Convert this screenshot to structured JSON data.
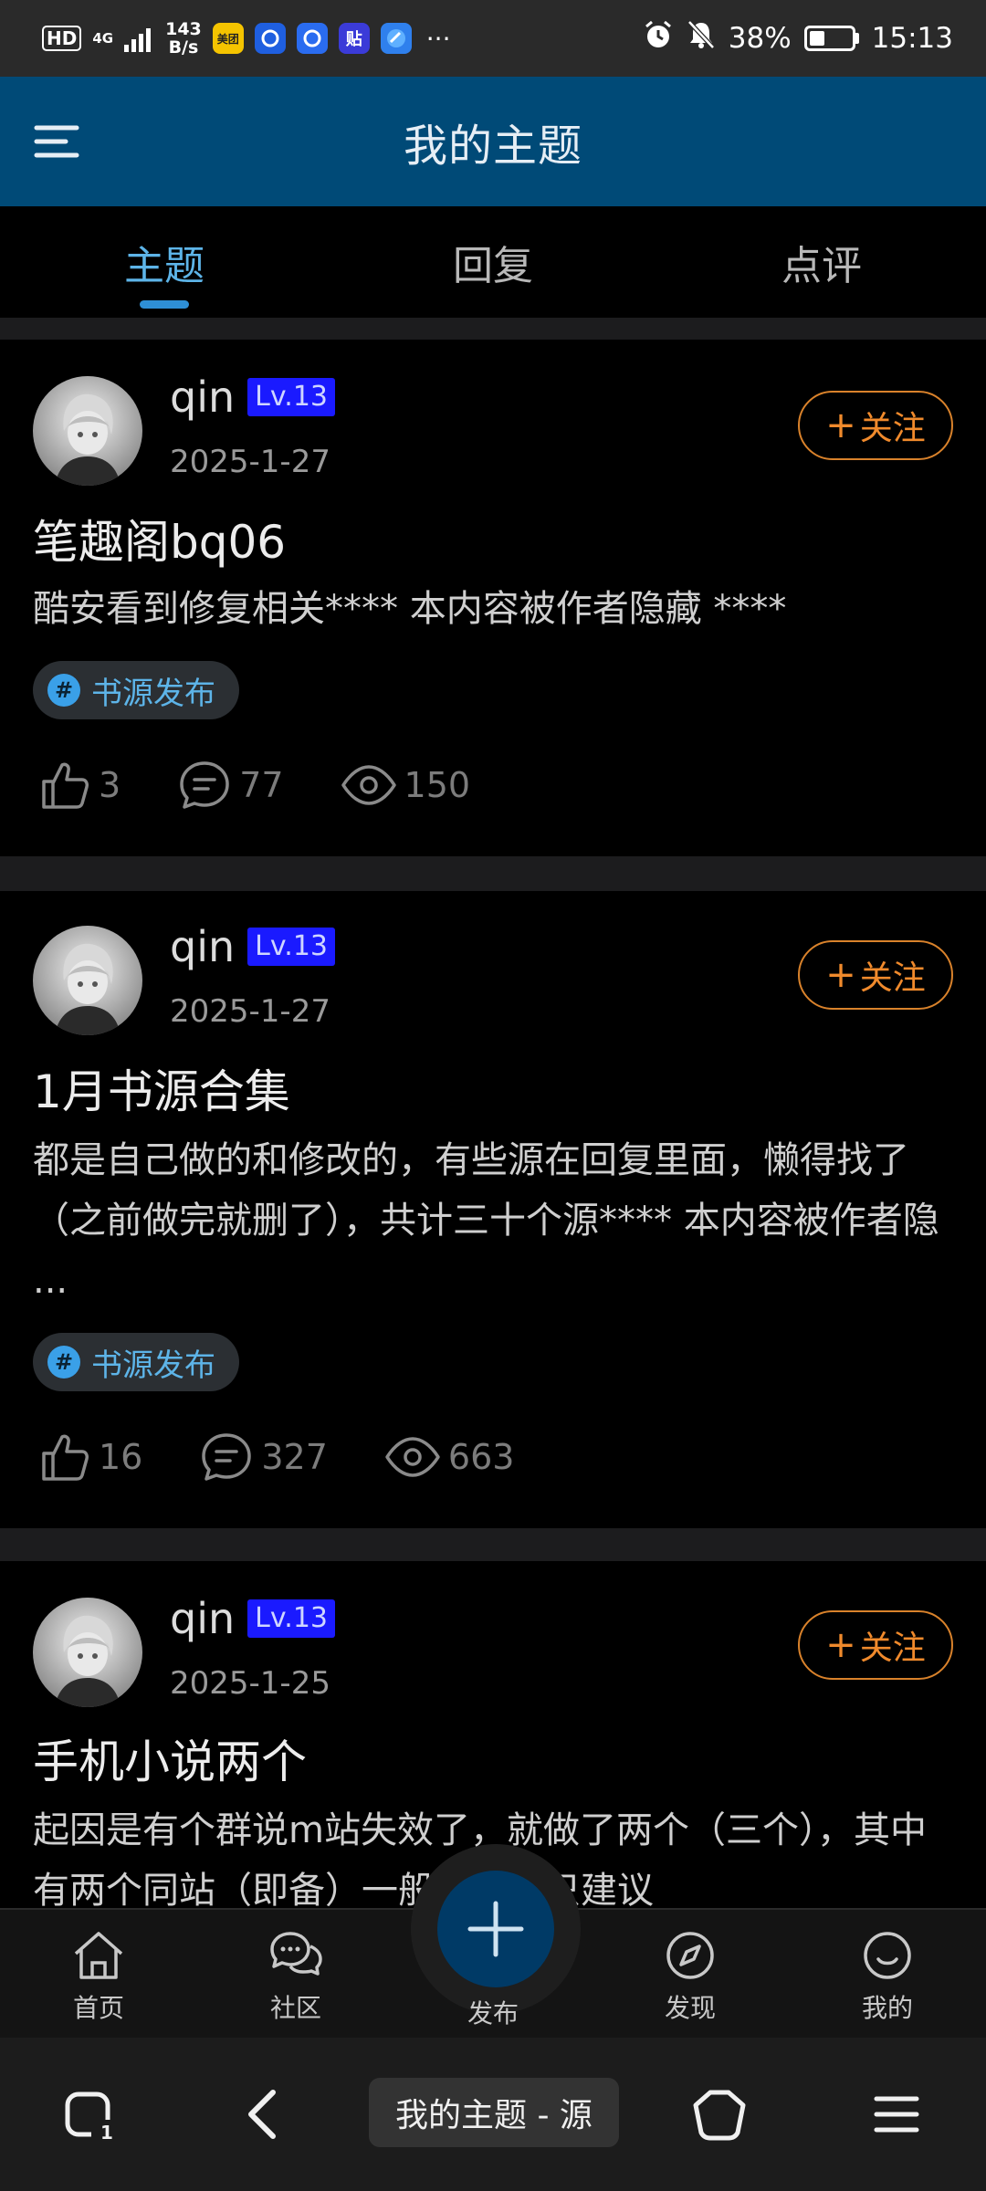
{
  "status_bar": {
    "hd": "HD",
    "network": "4G",
    "speed_value": "143",
    "speed_unit": "B/s",
    "app_icons": [
      "meituan-icon",
      "app-blue-icon",
      "app-blue2-icon",
      "tieba-icon",
      "browser-icon"
    ],
    "meituan_text": "美团",
    "tieba_text": "贴",
    "more": "···",
    "battery": "38%",
    "time": "15:13"
  },
  "header": {
    "title": "我的主题"
  },
  "tabs": [
    {
      "label": "主题",
      "active": true
    },
    {
      "label": "回复",
      "active": false
    },
    {
      "label": "点评",
      "active": false
    }
  ],
  "follow_label": "关注",
  "posts": [
    {
      "author": "qin",
      "level": "Lv.13",
      "date": "2025-1-27",
      "title": "笔趣阁bq06",
      "excerpt": "酷安看到修复相关**** 本内容被作者隐藏 ****",
      "tag": "书源发布",
      "likes": "3",
      "comments": "77",
      "views": "150"
    },
    {
      "author": "qin",
      "level": "Lv.13",
      "date": "2025-1-27",
      "title": "1月书源合集",
      "excerpt": "都是自己做的和修改的，有些源在回复里面，懒得找了（之前做完就删了），共计三十个源**** 本内容被作者隐 ...",
      "tag": "书源发布",
      "likes": "16",
      "comments": "327",
      "views": "663"
    },
    {
      "author": "qin",
      "level": "Lv.13",
      "date": "2025-1-25",
      "title": "手机小说两个",
      "excerpt": "起因是有个群说m站失效了，就做了两个（三个），其中有两个同站（即备）一般般吧，只建议"
    }
  ],
  "bottom_nav": {
    "items": [
      {
        "label": "首页",
        "icon": "home-icon"
      },
      {
        "label": "社区",
        "icon": "chat-bubbles-icon"
      },
      {
        "label": "发现",
        "icon": "compass-icon"
      },
      {
        "label": "我的",
        "icon": "smiley-icon"
      }
    ],
    "publish_label": "发布"
  },
  "system_nav": {
    "tab_count": "1",
    "page_label": "我的主题 - 源"
  },
  "colors": {
    "app_bar": "#004a77",
    "accent": "#5db4e8",
    "follow": "#f08a2c",
    "level_badge": "#1a1aff"
  }
}
